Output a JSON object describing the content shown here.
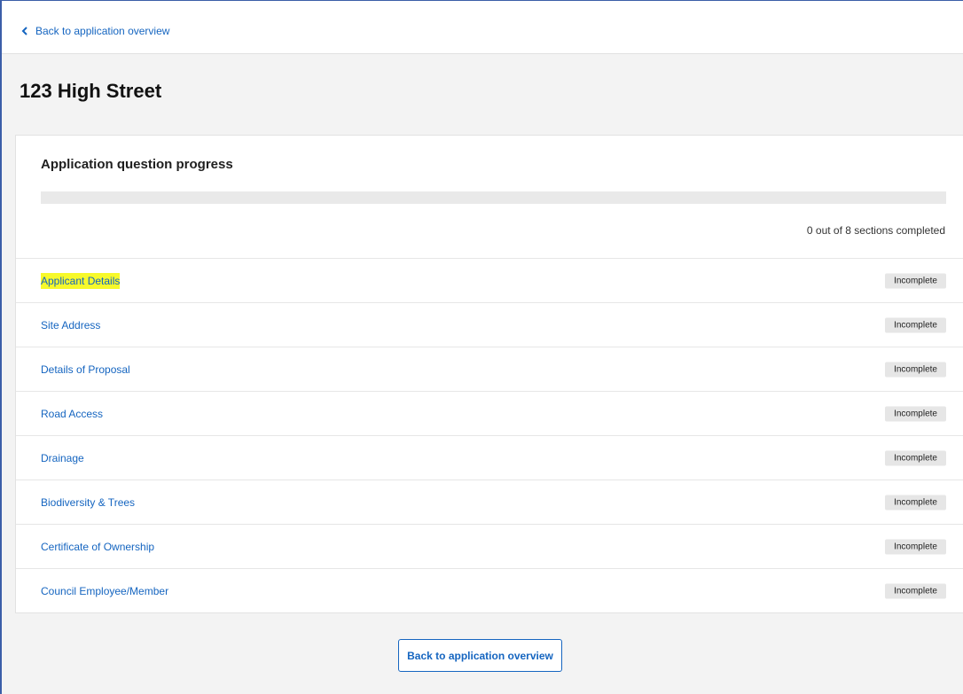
{
  "nav": {
    "back_label": "Back to application overview"
  },
  "page": {
    "title": "123 High Street"
  },
  "progress": {
    "heading": "Application question progress",
    "completed": 0,
    "total": 8,
    "summary": "0 out of 8 sections completed"
  },
  "sections": [
    {
      "label": "Applicant Details",
      "status": "Incomplete",
      "highlighted": true
    },
    {
      "label": "Site Address",
      "status": "Incomplete"
    },
    {
      "label": "Details of Proposal",
      "status": "Incomplete"
    },
    {
      "label": "Road Access",
      "status": "Incomplete"
    },
    {
      "label": "Drainage",
      "status": "Incomplete"
    },
    {
      "label": "Biodiversity & Trees",
      "status": "Incomplete"
    },
    {
      "label": "Certificate of Ownership",
      "status": "Incomplete"
    },
    {
      "label": "Council Employee/Member",
      "status": "Incomplete"
    }
  ],
  "footer": {
    "back_button_label": "Back to application overview"
  },
  "colors": {
    "link": "#1565c0",
    "highlight": "#f7f92a",
    "badge_bg": "#e6e6e6"
  },
  "icons": {
    "back": "chevron-left-icon"
  }
}
